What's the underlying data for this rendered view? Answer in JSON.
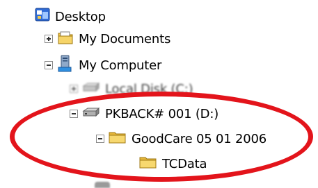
{
  "tree": {
    "items": [
      {
        "label": "Desktop",
        "icon": "desktop-icon",
        "toggle": "none"
      },
      {
        "label": "My Documents",
        "icon": "folder-documents-icon",
        "toggle": "plus"
      },
      {
        "label": "My Computer",
        "icon": "computer-icon",
        "toggle": "minus"
      },
      {
        "label": "Local Disk (C:)",
        "icon": "hard-drive-icon",
        "toggle": "plus"
      },
      {
        "label": "PKBACK# 001 (D:)",
        "icon": "hard-drive-icon",
        "toggle": "minus"
      },
      {
        "label": "GoodCare 05 01 2006",
        "icon": "folder-icon",
        "toggle": "minus"
      },
      {
        "label": "TCData",
        "icon": "folder-icon",
        "toggle": "none"
      }
    ]
  },
  "annotation": {
    "color": "#e3141b",
    "shape": "ellipse"
  }
}
